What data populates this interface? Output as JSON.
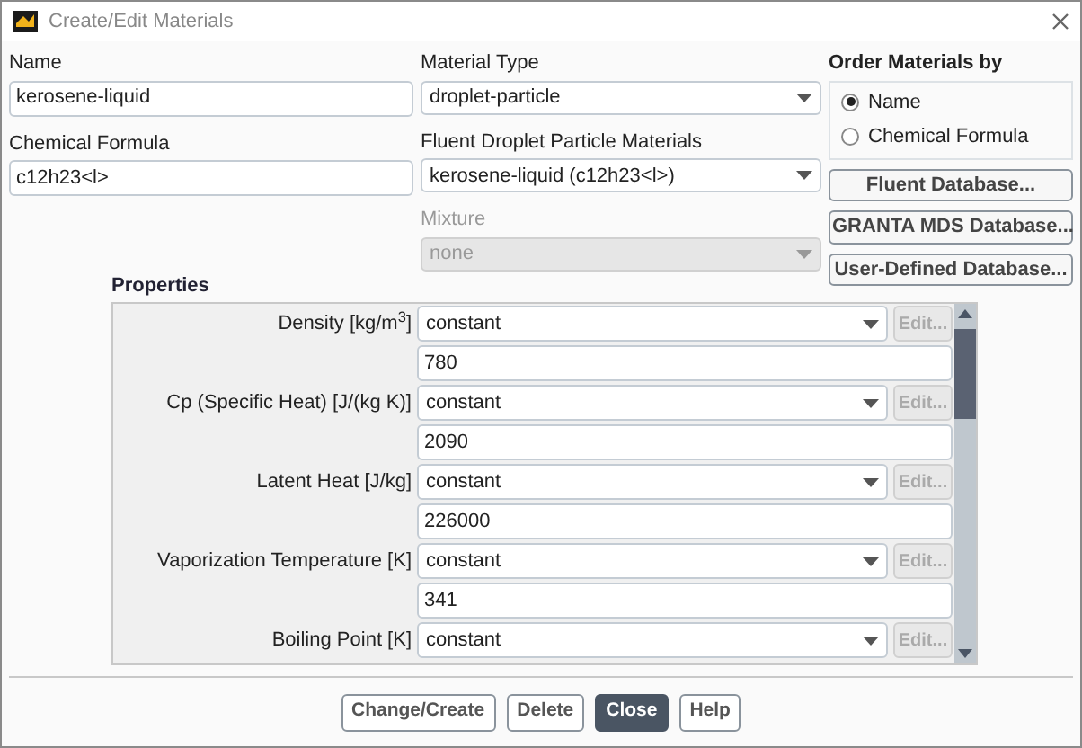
{
  "window": {
    "title": "Create/Edit Materials"
  },
  "name": {
    "label": "Name",
    "value": "kerosene-liquid"
  },
  "chemical_formula": {
    "label": "Chemical Formula",
    "value": "c12h23<l>"
  },
  "material_type": {
    "label": "Material Type",
    "value": "droplet-particle",
    "disabled": false
  },
  "fluent_materials": {
    "label": "Fluent Droplet Particle Materials",
    "value": "kerosene-liquid (c12h23<l>)",
    "disabled": false
  },
  "mixture": {
    "label": "Mixture",
    "value": "none",
    "disabled": true
  },
  "order_by": {
    "title": "Order Materials by",
    "options": [
      {
        "label": "Name",
        "selected": true
      },
      {
        "label": "Chemical Formula",
        "selected": false
      }
    ]
  },
  "database_buttons": [
    "Fluent Database...",
    "GRANTA MDS Database...",
    "User-Defined Database..."
  ],
  "properties": {
    "title": "Properties",
    "rows": [
      {
        "label": "Density [kg/m$^{3}$]",
        "method": "constant",
        "edit": "Edit...",
        "edit_disabled": true,
        "value": "780"
      },
      {
        "label": "Cp (Specific Heat) [J/(kg K)]",
        "method": "constant",
        "edit": "Edit...",
        "edit_disabled": true,
        "value": "2090"
      },
      {
        "label": "Latent Heat [J/kg]",
        "method": "constant",
        "edit": "Edit...",
        "edit_disabled": true,
        "value": "226000"
      },
      {
        "label": "Vaporization Temperature [K]",
        "method": "constant",
        "edit": "Edit...",
        "edit_disabled": true,
        "value": "341"
      },
      {
        "label": "Boiling Point [K]",
        "method": "constant",
        "edit": "Edit...",
        "edit_disabled": true
      }
    ]
  },
  "buttons": [
    {
      "label": "Change/Create",
      "primary": false
    },
    {
      "label": "Delete",
      "primary": false
    },
    {
      "label": "Close",
      "primary": true
    },
    {
      "label": "Help",
      "primary": false
    }
  ]
}
